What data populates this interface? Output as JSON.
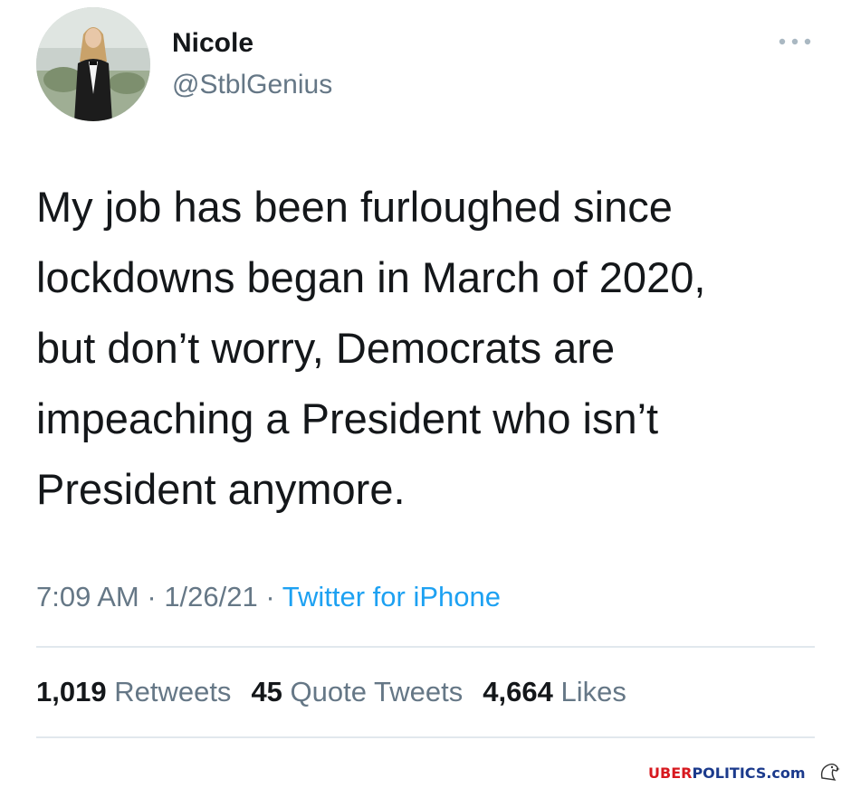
{
  "user": {
    "display_name": "Nicole",
    "handle": "@StblGenius",
    "avatar_icon": "profile-photo"
  },
  "tweet": {
    "text_lines": [
      "My job has been furloughed since",
      "lockdowns began in March of 2020,",
      "but don’t worry, Democrats are",
      "impeaching a President who isn’t",
      "President anymore."
    ],
    "time": "7:09 AM",
    "date": "1/26/21",
    "source": "Twitter for iPhone",
    "separator": " · "
  },
  "stats": [
    {
      "count": "1,019",
      "label": "Retweets"
    },
    {
      "count": "45",
      "label": "Quote Tweets"
    },
    {
      "count": "4,664",
      "label": "Likes"
    }
  ],
  "watermark": {
    "part1": "UBER",
    "part2": "POLITICS.com",
    "logo_icon": "eagle-icon"
  },
  "colors": {
    "text": "#14171a",
    "secondary": "#657786",
    "link": "#1da1f2",
    "divider": "#e1e8ed",
    "watermark_red": "#d7191f",
    "watermark_blue": "#1b3a8c"
  }
}
